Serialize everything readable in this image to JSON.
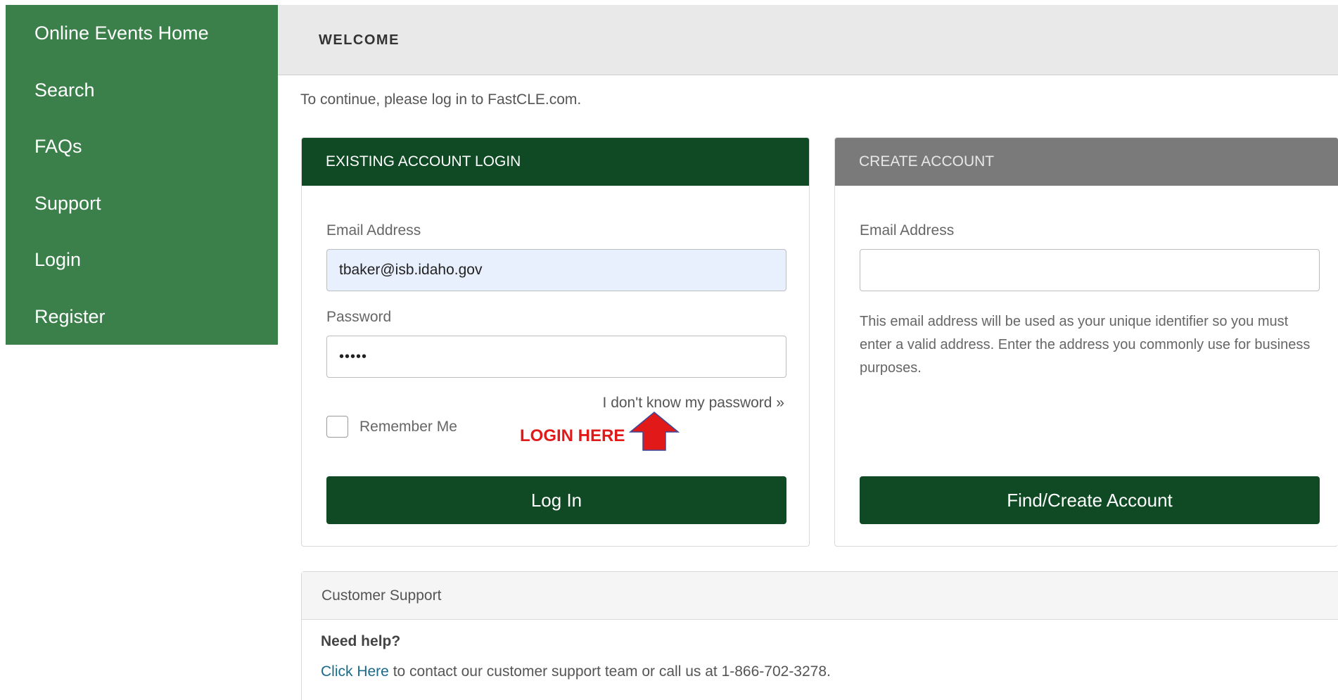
{
  "sidebar": {
    "items": [
      {
        "label": "Online Events Home"
      },
      {
        "label": "Search"
      },
      {
        "label": "FAQs"
      },
      {
        "label": "Support"
      },
      {
        "label": "Login"
      },
      {
        "label": "Register"
      }
    ]
  },
  "header": {
    "title": "WELCOME"
  },
  "intro_text": "To continue, please log in to FastCLE.com.",
  "login_panel": {
    "heading": "EXISTING ACCOUNT LOGIN",
    "email_label": "Email Address",
    "email_value": "tbaker@isb.idaho.gov",
    "password_label": "Password",
    "password_value": "•••••",
    "forgot_link": "I don't know my password »",
    "remember_label": "Remember Me",
    "remember_checked": false,
    "login_button": "Log In",
    "annotation": "LOGIN HERE"
  },
  "create_panel": {
    "heading": "CREATE ACCOUNT",
    "email_label": "Email Address",
    "email_value": "",
    "help_text": "This email address will be used as your unique identifier so you must enter a valid address. Enter the address you commonly use for business purposes.",
    "create_button": "Find/Create Account"
  },
  "support": {
    "heading": "Customer Support",
    "need_help": "Need help?",
    "link_text": "Click Here",
    "line_text": " to contact our customer support team or call us at 1-866-702-3278."
  },
  "colors": {
    "sidebar_bg": "#3b7f4a",
    "primary_dark_green": "#0f4a24",
    "create_header_gray": "#7a7a7a",
    "annotation_red": "#e11919",
    "link_teal": "#1a6a8a"
  },
  "icons": {
    "annotation_arrow": "red-up-arrow-icon"
  }
}
